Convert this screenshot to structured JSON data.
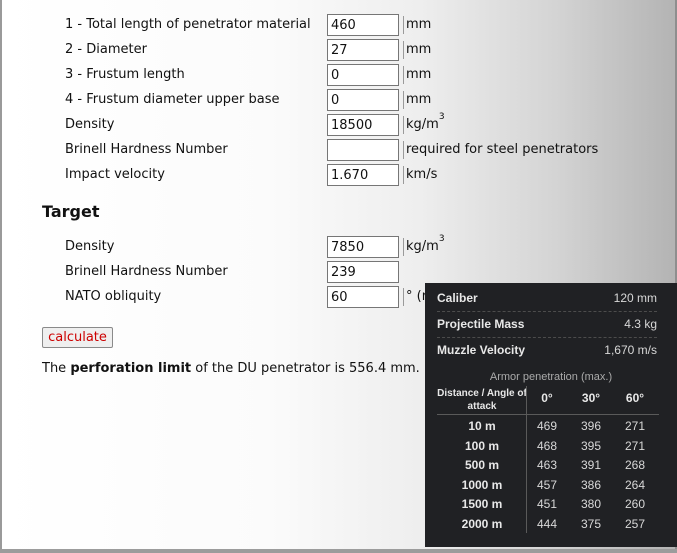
{
  "penetrator": {
    "rows": [
      {
        "label": "1 - Total length of penetrator material",
        "value": "460",
        "unit": "mm"
      },
      {
        "label": "2 - Diameter",
        "value": "27",
        "unit": "mm"
      },
      {
        "label": "3 - Frustum length",
        "value": "0",
        "unit": "mm"
      },
      {
        "label": "4 - Frustum diameter upper base",
        "value": "0",
        "unit": "mm"
      },
      {
        "label": "Density",
        "value": "18500",
        "unit": "kg/m",
        "unit_sup": "3"
      },
      {
        "label": "Brinell Hardness Number",
        "value": "",
        "unit": "required for steel penetrators"
      },
      {
        "label": "Impact velocity",
        "value": "1.670",
        "unit": "km/s"
      }
    ]
  },
  "target": {
    "heading": "Target",
    "rows": [
      {
        "label": "Density",
        "value": "7850",
        "unit": "kg/m",
        "unit_sup": "3"
      },
      {
        "label": "Brinell Hardness Number",
        "value": "239",
        "unit": ""
      },
      {
        "label": "NATO obliquity",
        "value": "60",
        "unit": "° (r"
      }
    ]
  },
  "calculate_label": "calculate",
  "result": {
    "prefix": "The ",
    "bold": "perforation limit",
    "suffix": " of the DU penetrator is 556.4 mm."
  },
  "tooltip": {
    "specs": [
      {
        "key": "Caliber",
        "value": "120 mm"
      },
      {
        "key": "Projectile Mass",
        "value": "4.3 kg"
      },
      {
        "key": "Muzzle Velocity",
        "value": "1,670 m/s"
      }
    ],
    "caption": "Armor penetration (max.)",
    "header_first": "Distance / Angle of attack",
    "angles": [
      "0°",
      "30°",
      "60°"
    ],
    "rows": [
      {
        "distance": "10 m",
        "values": [
          "469",
          "396",
          "271"
        ]
      },
      {
        "distance": "100 m",
        "values": [
          "468",
          "395",
          "271"
        ]
      },
      {
        "distance": "500 m",
        "values": [
          "463",
          "391",
          "268"
        ]
      },
      {
        "distance": "1000 m",
        "values": [
          "457",
          "386",
          "264"
        ]
      },
      {
        "distance": "1500 m",
        "values": [
          "451",
          "380",
          "260"
        ]
      },
      {
        "distance": "2000 m",
        "values": [
          "444",
          "375",
          "257"
        ]
      }
    ]
  }
}
